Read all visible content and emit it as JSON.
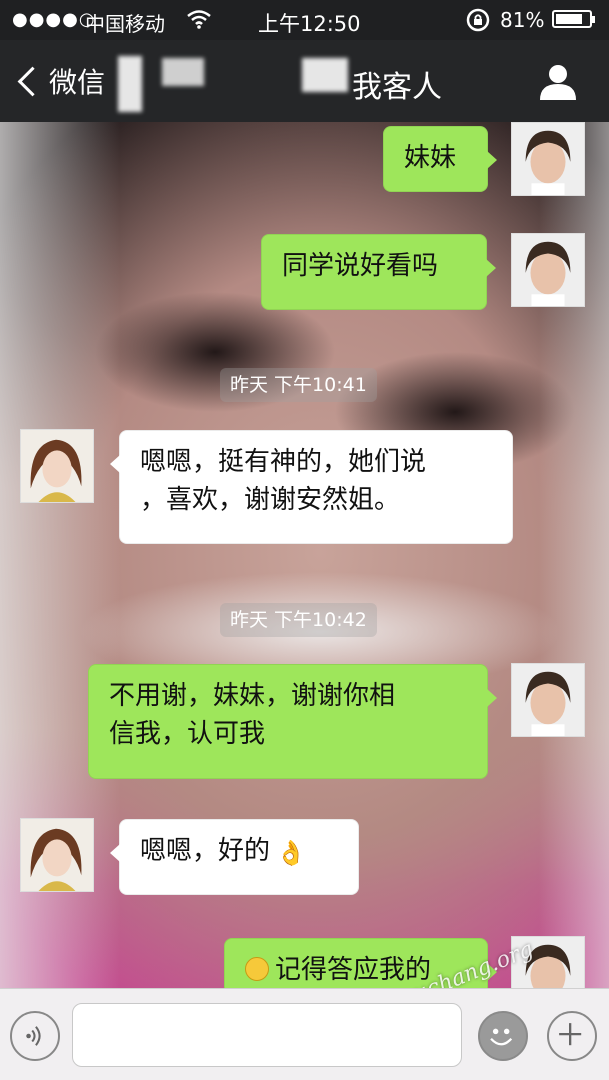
{
  "status_bar": {
    "signal": "●●●●○",
    "carrier": "中国移动",
    "time": "上午12:50",
    "battery": "81%",
    "battery_level": 0.81
  },
  "nav": {
    "back_label": "微信",
    "title": "我客人"
  },
  "timestamps": [
    "昨天 下午10:41",
    "昨天 下午10:42"
  ],
  "messages": [
    {
      "side": "mine",
      "text": "妹妹"
    },
    {
      "side": "mine",
      "text": "同学说好看吗"
    },
    {
      "side": "theirs",
      "line1": "嗯嗯，挺有神的，她们说",
      "line2": "，喜欢，谢谢安然姐。"
    },
    {
      "side": "mine",
      "line1": "不用谢，妹妹，谢谢你相",
      "line2": "信我，认可我"
    },
    {
      "side": "theirs",
      "text": "嗯嗯，好的"
    },
    {
      "side": "mine",
      "text": "记得答应我的"
    }
  ],
  "icons": {
    "ok_hand": "👌",
    "smile_emoji": "smile-emoji-icon"
  },
  "input": {
    "placeholder": ""
  },
  "watermark": "xuchang.org",
  "colors": {
    "my_bubble": "#9ee65b",
    "their_bubble": "#ffffff",
    "nav_bar": "#252628"
  }
}
